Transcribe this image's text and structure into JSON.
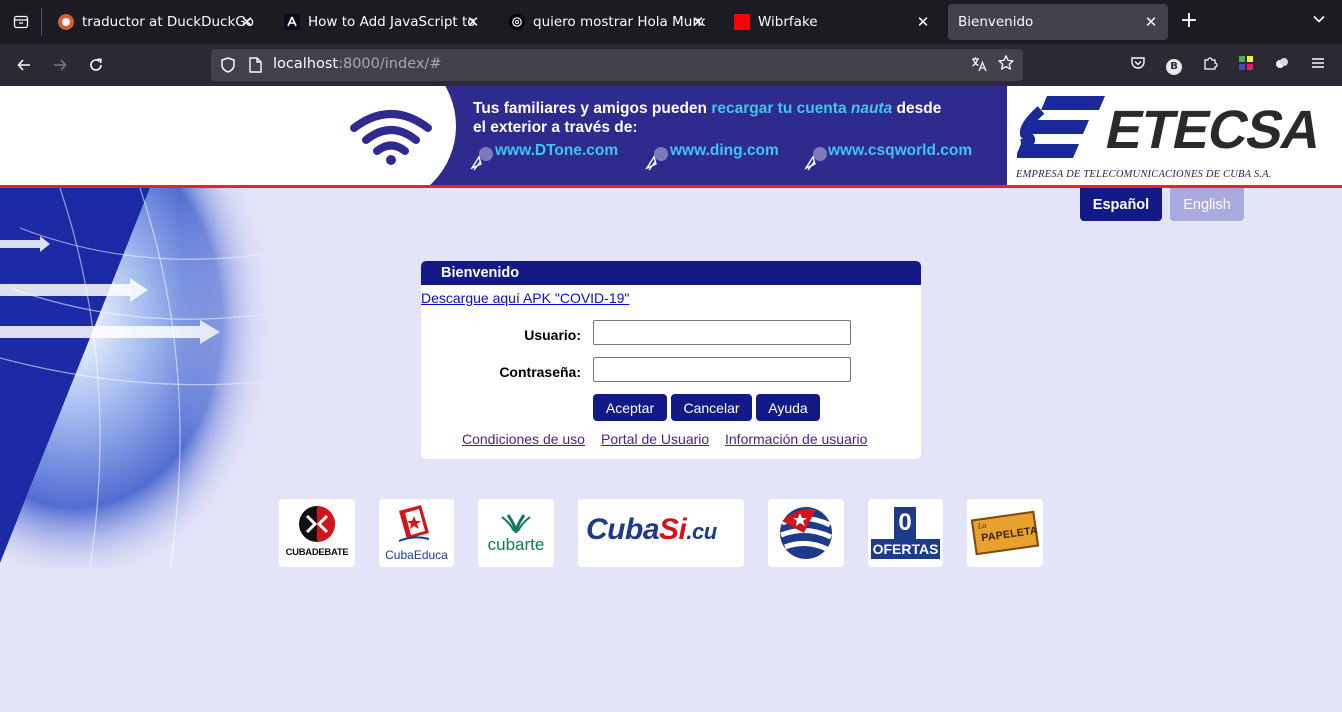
{
  "browser": {
    "tabs": [
      {
        "title": "traductor at DuckDuckGo",
        "icon": "duckduckgo-icon"
      },
      {
        "title": "How to Add JavaScript to Y",
        "icon": "angular-icon"
      },
      {
        "title": "quiero mostrar Hola Mundo",
        "icon": "openai-icon"
      },
      {
        "title": "Wibrfake",
        "icon": "red-square-icon"
      },
      {
        "title": "Bienvenido",
        "icon": "none",
        "active": true
      }
    ],
    "close_glyph": "✕",
    "new_tab_glyph": "+",
    "url_host": "localhost",
    "url_rest": ":8000/index/#",
    "profile_letter": "B",
    "colors": {
      "tabbar": "#1c1b22",
      "navbar": "#2b2a33",
      "urlbar": "#42414d"
    }
  },
  "page": {
    "banner": {
      "line1_a": "Tus familiares y amigos pueden ",
      "line1_b": "recargar tu cuenta ",
      "line1_c": "nauta",
      "line1_d": " desde",
      "line2": "el exterior a través de:",
      "sites": [
        "www.DTone.com",
        "www.ding.com",
        "www.csqworld.com"
      ]
    },
    "brand": {
      "name": "ETECSA",
      "subtitle": "EMPRESA DE TELECOMUNICACIONES DE  CUBA S.A."
    },
    "language": {
      "es": "Español",
      "en": "English"
    },
    "login": {
      "title": "Bienvenido",
      "apk_link": "Descargue aquí APK \"COVID-19\"",
      "user_label": "Usuario:",
      "user_value": "",
      "password_label": "Contraseña:",
      "password_value": "",
      "buttons": {
        "accept": "Aceptar",
        "cancel": "Cancelar",
        "help": "Ayuda"
      },
      "links": {
        "terms": "Condiciones de uso",
        "portal": "Portal de Usuario",
        "info": "Información de usuario"
      }
    },
    "partners": [
      {
        "name": "cubadebate",
        "text": "CUBADEBATE"
      },
      {
        "name": "cubaeduca",
        "text": "CubaEduca"
      },
      {
        "name": "cubarte",
        "text": "cubarte"
      },
      {
        "name": "cubasi",
        "text_a": "Cuba",
        "text_b": "Si",
        "text_c": ".cu"
      },
      {
        "name": "cuban-flag-ball",
        "text": ""
      },
      {
        "name": "ofertas",
        "text_top": "0",
        "text": "OFERTAS"
      },
      {
        "name": "papeleta",
        "text_a": "La",
        "text": "PAPELETA"
      }
    ],
    "colors": {
      "primary": "#131a85",
      "page_bg": "#e4e4f8",
      "red_rule": "#e3262c",
      "banner": "#2f2a8e",
      "banner_highlight": "#3fc6ef"
    }
  }
}
